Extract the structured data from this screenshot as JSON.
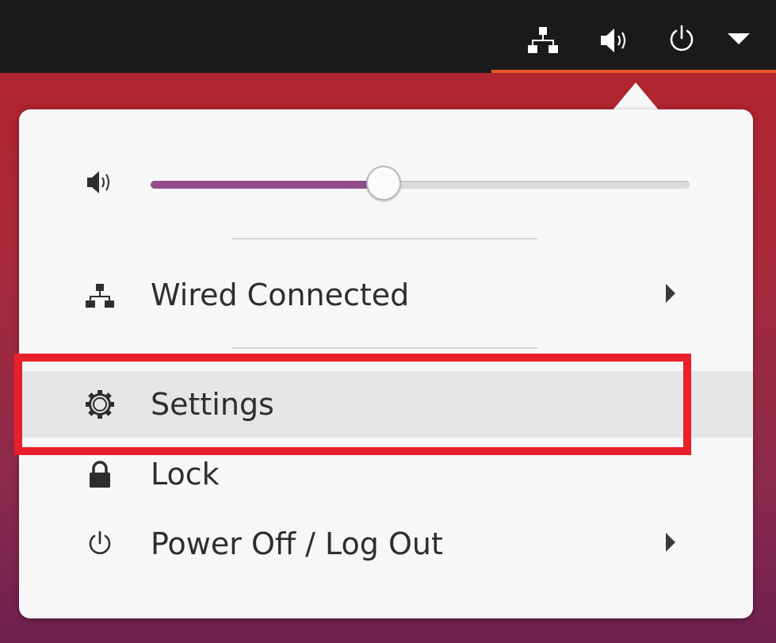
{
  "top_bar": {
    "icons": [
      "network-wired-icon",
      "volume-icon",
      "power-icon",
      "dropdown-arrow-icon"
    ],
    "accent_color": "#e8562b"
  },
  "system_menu": {
    "volume": {
      "icon": "volume-icon",
      "level_percent": 45,
      "fill_color": "#924d8b"
    },
    "items": [
      {
        "label": "Wired Connected",
        "icon": "network-wired-icon",
        "has_submenu": true
      },
      {
        "label": "Settings",
        "icon": "gear-icon",
        "has_submenu": false,
        "highlighted": true
      },
      {
        "label": "Lock",
        "icon": "lock-icon",
        "has_submenu": false
      },
      {
        "label": "Power Off / Log Out",
        "icon": "power-icon",
        "has_submenu": true
      }
    ]
  },
  "annotation": {
    "highlight_color": "#e8202a",
    "target": "Settings"
  }
}
